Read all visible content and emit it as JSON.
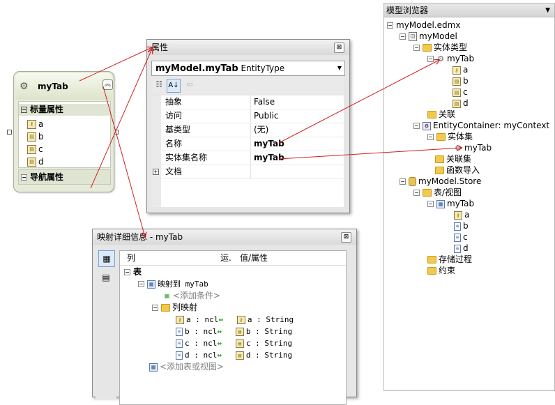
{
  "entity_shape": {
    "name": "myTab",
    "scalar_section": "标量属性",
    "properties": [
      "a",
      "b",
      "c",
      "d"
    ],
    "nav_section": "导航属性"
  },
  "properties_window": {
    "title": "属性",
    "object_name": "myModel.myTab",
    "object_type": "EntityType",
    "rows": [
      {
        "name": "抽象",
        "value": "False",
        "bold": false
      },
      {
        "name": "访问",
        "value": "Public",
        "bold": false
      },
      {
        "name": "基类型",
        "value": "(无)",
        "bold": false
      },
      {
        "name": "名称",
        "value": "myTab",
        "bold": true
      },
      {
        "name": "实体集名称",
        "value": "myTab",
        "bold": true
      },
      {
        "name": "文档",
        "value": "",
        "bold": false
      }
    ]
  },
  "mapping_window": {
    "title": "映射详细信息 - myTab",
    "columns": [
      "列",
      "运.",
      "值/属性"
    ],
    "table_node": "表",
    "maps_to": "映射到 myTab",
    "add_condition": "<添加条件>",
    "column_mappings_label": "列映射",
    "mappings": [
      {
        "column": "a : ncl",
        "property": "a : String"
      },
      {
        "column": "b : ncl",
        "property": "b : String"
      },
      {
        "column": "c : ncl",
        "property": "c : String"
      },
      {
        "column": "d : ncl",
        "property": "d : String"
      }
    ],
    "add_table": "<添加表或视图>"
  },
  "model_browser": {
    "title": "模型浏览器",
    "root": "myModel.edmx",
    "model": "myModel",
    "entity_types": "实体类型",
    "entity": "myTab",
    "entity_props": [
      "a",
      "b",
      "c",
      "d"
    ],
    "associations": "关联",
    "container": "EntityContainer: myContext",
    "entity_sets": "实体集",
    "entity_set": "myTab",
    "association_sets": "关联集",
    "function_imports": "函数导入",
    "store": "myModel.Store",
    "tables_views": "表/视图",
    "table": "myTab",
    "table_columns": [
      "a",
      "b",
      "c",
      "d"
    ],
    "stored_procedures": "存储过程",
    "constraints": "约束"
  },
  "colors": {
    "arrow": "#d02020",
    "accent_green": "#21a321"
  }
}
